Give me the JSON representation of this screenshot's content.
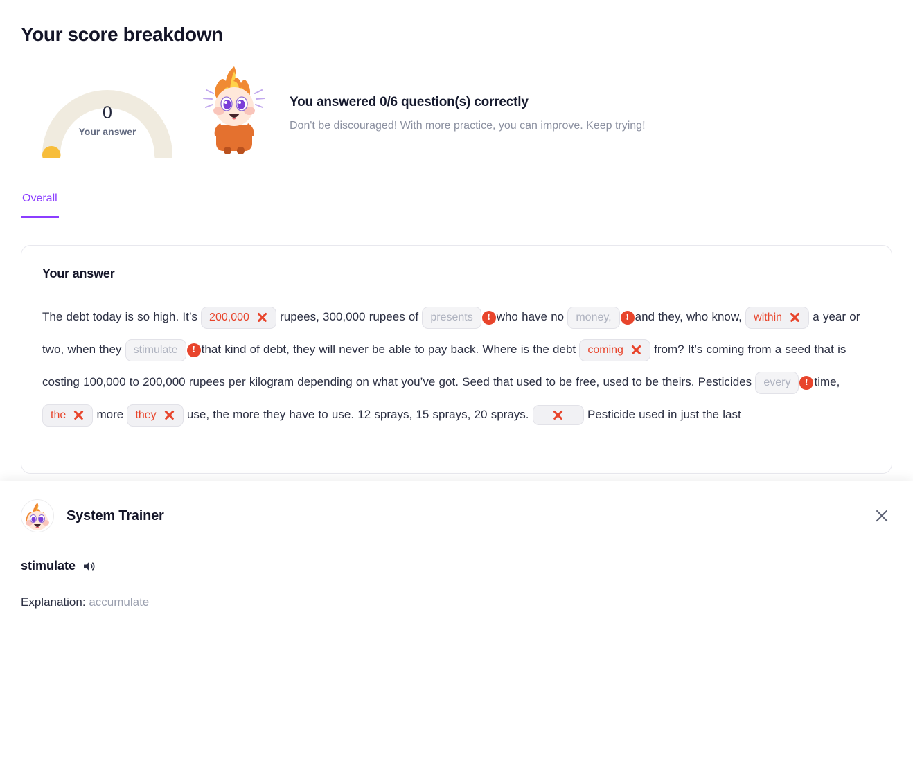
{
  "page": {
    "title": "Your score breakdown"
  },
  "score": {
    "value": "0",
    "label": "Your answer",
    "heading": "You answered 0/6 question(s) correctly",
    "subtext": "Don't be discouraged! With more practice, you can improve. Keep trying!",
    "gauge_track_color": "#f0ebdf",
    "gauge_fill_color": "#f7bd3a",
    "gauge_percent": 0,
    "correct": 0,
    "total": 6
  },
  "tabs": [
    {
      "label": "Overall",
      "active": true,
      "accent": "#8b3dff"
    }
  ],
  "answer_card": {
    "title": "Your answer",
    "segments": [
      {
        "type": "text",
        "text": "The debt today is so high. It’s "
      },
      {
        "type": "chip-wrong",
        "text": "200,000"
      },
      {
        "type": "text",
        "text": " rupees, 300,000 rupees of "
      },
      {
        "type": "chip-blank",
        "text": "presents"
      },
      {
        "type": "alert"
      },
      {
        "type": "text",
        "text": "who have no "
      },
      {
        "type": "chip-blank",
        "text": "money,"
      },
      {
        "type": "alert"
      },
      {
        "type": "text",
        "text": "and they, who know, "
      },
      {
        "type": "chip-wrong",
        "text": "within"
      },
      {
        "type": "text",
        "text": " a year or two, when they "
      },
      {
        "type": "chip-blank",
        "text": "stimulate"
      },
      {
        "type": "alert"
      },
      {
        "type": "text",
        "text": "that kind of debt, they will never be able to pay back. Where is the debt "
      },
      {
        "type": "chip-wrong",
        "text": "coming"
      },
      {
        "type": "text",
        "text": " from? It’s coming from a seed that is costing 100,000 to 200,000 rupees per kilogram depending on what you’ve got. Seed that used to be free, used to be theirs. Pesticides "
      },
      {
        "type": "chip-blank",
        "text": "every"
      },
      {
        "type": "alert"
      },
      {
        "type": "text",
        "text": "time, "
      },
      {
        "type": "chip-wrong",
        "text": "the"
      },
      {
        "type": "text",
        "text": " more "
      },
      {
        "type": "chip-wrong",
        "text": "they"
      },
      {
        "type": "text",
        "text": " use, the more they have to use. 12 sprays, 15 sprays, 20 sprays. "
      },
      {
        "type": "chip-empty",
        "text": ""
      },
      {
        "type": "text",
        "text": " Pesticide used in just the last"
      }
    ]
  },
  "overlay": {
    "title": "System Trainer",
    "word": "stimulate",
    "speaker_icon": "speaker-icon",
    "close_icon": "close-icon",
    "explanation_label": "Explanation:",
    "explanation_value": "accumulate"
  }
}
